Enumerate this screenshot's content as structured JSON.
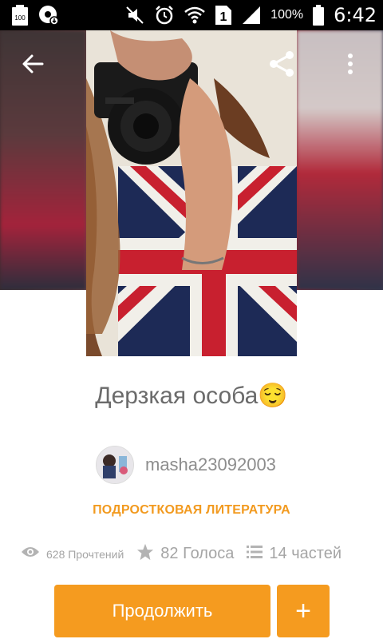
{
  "status_bar": {
    "battery_left_text": "100",
    "battery_percent": "100%",
    "time": "6:42",
    "sim_slot": "1",
    "icons": [
      "battery-left-icon",
      "download-status-icon",
      "mute-icon",
      "alarm-icon",
      "wifi-icon",
      "sim-slot-icon",
      "signal-icon",
      "battery-icon"
    ]
  },
  "toolbar": {
    "back_icon": "arrow-back-icon",
    "share_icon": "share-icon",
    "more_icon": "more-vertical-icon"
  },
  "story": {
    "title": "Дерзкая особа😌",
    "author": "masha23092003",
    "genre": "ПОДРОСТКОВАЯ ЛИТЕРАТУРА",
    "reads": "628 Прочтений",
    "votes": "82 Голоса",
    "parts": "14 частей"
  },
  "actions": {
    "continue_label": "Продолжить",
    "add_label": "+"
  },
  "colors": {
    "accent": "#f59b1f",
    "genre": "#f29a1f",
    "text_gray": "#6b6b6b",
    "meta_gray": "#a5a5a5"
  }
}
